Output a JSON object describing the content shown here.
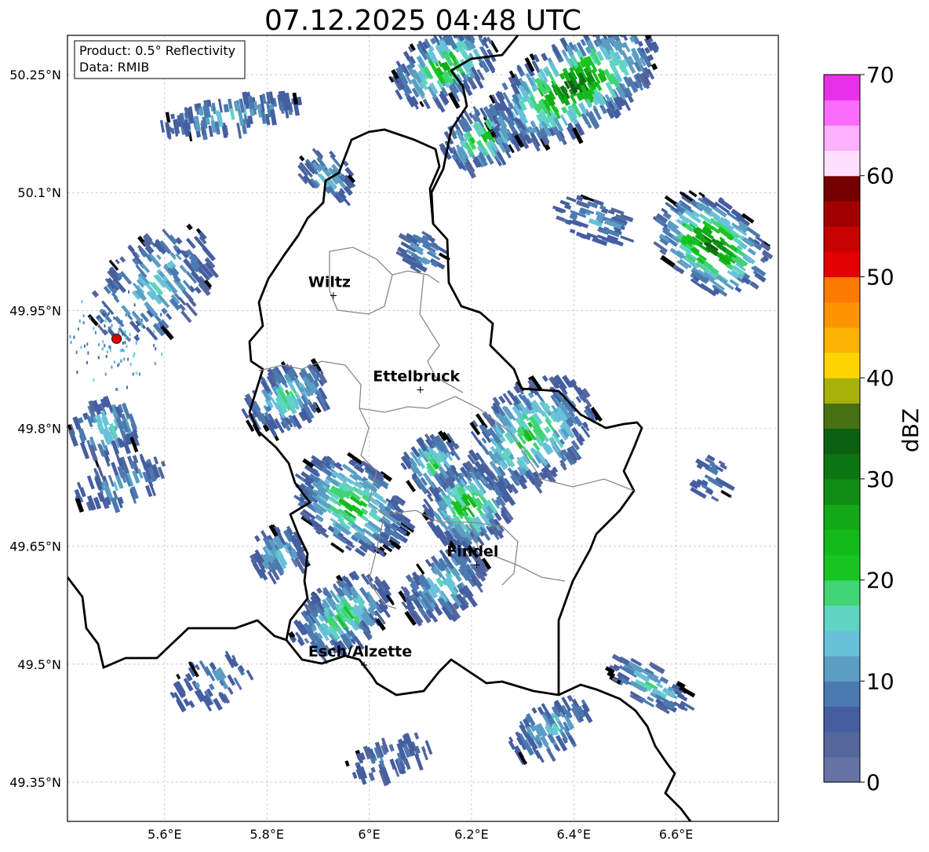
{
  "title": "07.12.2025 04:48 UTC",
  "info_box": {
    "product": "Product: 0.5° Reflectivity",
    "data": "Data: RMIB"
  },
  "axes": {
    "lon_ticks": [
      "5.6°E",
      "5.8°E",
      "6°E",
      "6.2°E",
      "6.4°E",
      "6.6°E"
    ],
    "lat_ticks": [
      "50.25°N",
      "50.1°N",
      "49.95°N",
      "49.8°N",
      "49.65°N",
      "49.5°N",
      "49.35°N"
    ],
    "lon_range": [
      5.41,
      6.8
    ],
    "lat_range": [
      49.3,
      50.3
    ],
    "grid": true
  },
  "cities": [
    {
      "name": "Wiltz",
      "lon": 5.93,
      "lat": 49.97
    },
    {
      "name": "Ettelbruck",
      "lon": 6.1,
      "lat": 49.85
    },
    {
      "name": "Findel",
      "lon": 6.21,
      "lat": 49.627
    },
    {
      "name": "Esch/Alzette",
      "lon": 5.99,
      "lat": 49.5
    }
  ],
  "radar_site": {
    "lon": 5.506,
    "lat": 49.914,
    "color": "#e00000"
  },
  "colorbar": {
    "label": "dBZ",
    "ticks": [
      "0",
      "10",
      "20",
      "30",
      "40",
      "50",
      "60",
      "70"
    ],
    "min": 0,
    "max": 70,
    "step": 2.5,
    "colors": [
      "#6473a3",
      "#53679d",
      "#455ea0",
      "#4b7ab0",
      "#5b9dc3",
      "#68c1d9",
      "#5fd4c3",
      "#41d474",
      "#16c51f",
      "#14b91a",
      "#13a918",
      "#108d14",
      "#0c7712",
      "#0b6111",
      "#467212",
      "#a8b00a",
      "#fdd400",
      "#fcb200",
      "#fc9400",
      "#fc7a00",
      "#e30000",
      "#c70000",
      "#a20000",
      "#740000",
      "#fee0fe",
      "#fdb0fd",
      "#fb6bfb",
      "#e930e9"
    ]
  },
  "legend_note": ""
}
